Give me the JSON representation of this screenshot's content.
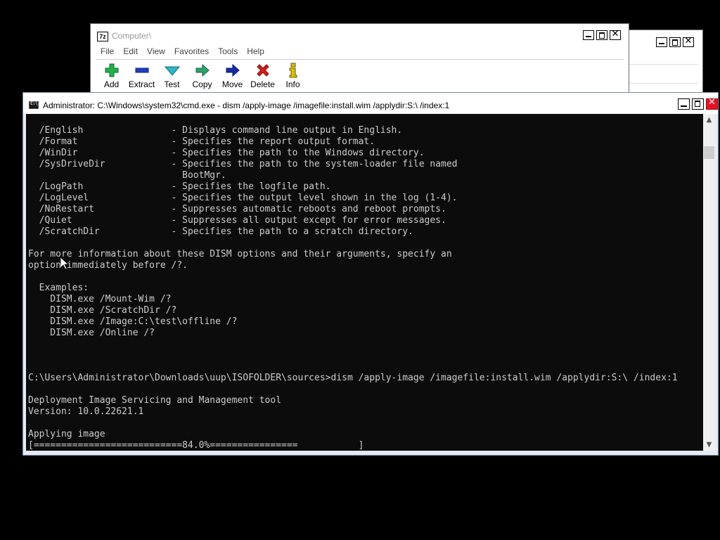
{
  "sevenzip": {
    "app_icon": "7z",
    "title": "Computer\\",
    "menu": [
      "File",
      "Edit",
      "View",
      "Favorites",
      "Tools",
      "Help"
    ],
    "toolbar": [
      {
        "label": "Add",
        "icon": "plus-icon",
        "color": "#22b14c"
      },
      {
        "label": "Extract",
        "icon": "minus-icon",
        "color": "#1f3fbf"
      },
      {
        "label": "Test",
        "icon": "check-icon",
        "color": "#2bb5c8"
      },
      {
        "label": "Copy",
        "icon": "arrow-right-icon",
        "color": "#2aa36b"
      },
      {
        "label": "Move",
        "icon": "arrow-right-icon",
        "color": "#1a2aa0"
      },
      {
        "label": "Delete",
        "icon": "x-icon",
        "color": "#d81e1e"
      },
      {
        "label": "Info",
        "icon": "info-icon",
        "color": "#e0c000"
      }
    ]
  },
  "cmd": {
    "title": "Administrator: C:\\Windows\\system32\\cmd.exe - dism  /apply-image /imagefile:install.wim /applydir:S:\\ /index:1",
    "output": "  /English                - Displays command line output in English.\n  /Format                 - Specifies the report output format.\n  /WinDir                 - Specifies the path to the Windows directory.\n  /SysDriveDir            - Specifies the path to the system-loader file named\n                            BootMgr.\n  /LogPath                - Specifies the logfile path.\n  /LogLevel               - Specifies the output level shown in the log (1-4).\n  /NoRestart              - Suppresses automatic reboots and reboot prompts.\n  /Quiet                  - Suppresses all output except for error messages.\n  /ScratchDir             - Specifies the path to a scratch directory.\n\nFor more information about these DISM options and their arguments, specify an\noption immediately before /?.\n\n  Examples:\n    DISM.exe /Mount-Wim /?\n    DISM.exe /ScratchDir /?\n    DISM.exe /Image:C:\\test\\offline /?\n    DISM.exe /Online /?\n\n\n\nC:\\Users\\Administrator\\Downloads\\uup\\ISOFOLDER\\sources>dism /apply-image /imagefile:install.wim /applydir:S:\\ /index:1\n\nDeployment Image Servicing and Management tool\nVersion: 10.0.22621.1\n\nApplying image\n[===========================84.0%================           ]",
    "progress_percent": 84.0
  },
  "colors": {
    "console_bg": "#0c0c0c",
    "console_fg": "#cccccc",
    "close_red": "#e81123"
  }
}
